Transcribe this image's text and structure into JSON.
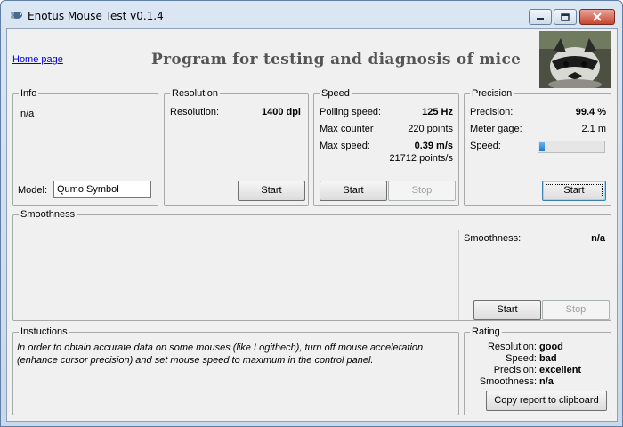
{
  "window": {
    "title": "Enotus Mouse Test v0.1.4"
  },
  "header": {
    "home_link": "Home page",
    "headline": "Program for testing and diagnosis of mice"
  },
  "info": {
    "legend": "Info",
    "status": "n/a",
    "model_label": "Model:",
    "model_value": "Qumo Symbol"
  },
  "resolution": {
    "legend": "Resolution",
    "label": "Resolution:",
    "value": "1400 dpi",
    "start": "Start"
  },
  "speed": {
    "legend": "Speed",
    "polling_label": "Polling speed:",
    "polling_value": "125 Hz",
    "counter_label": "Max counter",
    "counter_value": "220 points",
    "max_speed_label": "Max  speed:",
    "max_speed_value": "0.39 m/s",
    "points_value": "21712 points/s",
    "start": "Start",
    "stop": "Stop"
  },
  "precision": {
    "legend": "Precision",
    "precision_label": "Precision:",
    "precision_value": "99.4 %",
    "gage_label": "Meter gage:",
    "gage_value": "2.1 m",
    "speed_label": "Speed:",
    "speed_level": 0.08,
    "start": "Start"
  },
  "smoothness": {
    "legend": "Smoothness",
    "label": "Smoothness:",
    "value": "n/a",
    "start": "Start",
    "stop": "Stop"
  },
  "instructions": {
    "legend": "Instuctions",
    "text": "In order to obtain accurate data on some mouses (like Logithech), turn off mouse acceleration (enhance cursor precision) and set mouse speed to maximum in the control panel."
  },
  "rating": {
    "legend": "Rating",
    "resolution_label": "Resolution:",
    "resolution_value": "good",
    "speed_label": "Speed:",
    "speed_value": "bad",
    "precision_label": "Precision:",
    "precision_value": "excellent",
    "smoothness_label": "Smoothness:",
    "smoothness_value": "n/a",
    "copy_button": "Copy report to clipboard"
  },
  "colors": {
    "link": "#0000ee",
    "meter_fill": "#1e78d0",
    "title_bar": "#dbe6f3"
  },
  "icons": [
    "app-mouse-icon",
    "minimize-icon",
    "maximize-icon",
    "close-icon"
  ]
}
